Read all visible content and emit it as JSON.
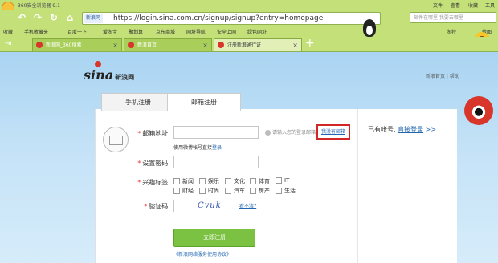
{
  "browser": {
    "title": "360安全浏览器 9.1",
    "window_menu": [
      "文件",
      "查看",
      "收藏",
      "工具"
    ],
    "url_badge": "新浪网",
    "url": "https://login.sina.com.cn/signup/signup?entry=homepage",
    "search_placeholder": "邮件在哪里 我要去哪里",
    "bookmarks": [
      "收藏",
      "手机收藏夹",
      "百度一下",
      "爱淘宝",
      "聚划算",
      "京东商城",
      "网址导航",
      "安全上网",
      "绿色网址",
      "淘特",
      "截图"
    ],
    "tabs": [
      {
        "label": "新浪网_360搜索",
        "active": false
      },
      {
        "label": "新浪首页",
        "active": false
      },
      {
        "label": "注册新浪通行证",
        "active": true
      }
    ],
    "new_tab": "+"
  },
  "page": {
    "logo": "sina",
    "logo_cn": "新浪网",
    "top_links": "新浪首页 | 帮助",
    "tabs": [
      "手机注册",
      "邮箱注册"
    ],
    "form": {
      "email_label": "邮箱地址:",
      "email_hint": "请输入您的登录邮箱",
      "no_email_link": "我没有邮箱",
      "weibo_text": "使用微博帐号直接",
      "weibo_link": "登录",
      "password_label": "设置密码:",
      "interest_label": "兴趣标签:",
      "interests": [
        "新闻",
        "娱乐",
        "文化",
        "体育",
        "IT",
        "财经",
        "时尚",
        "汽车",
        "房产",
        "生活"
      ],
      "captcha_label": "验证码:",
      "captcha_text": "Cvuk",
      "captcha_refresh": "看不清?",
      "submit": "立即注册",
      "agreement": "《新浪网络服务使用协议》"
    },
    "have_account": "已有帐号,",
    "login_link": "直接登录",
    "login_arrow": ">>"
  }
}
